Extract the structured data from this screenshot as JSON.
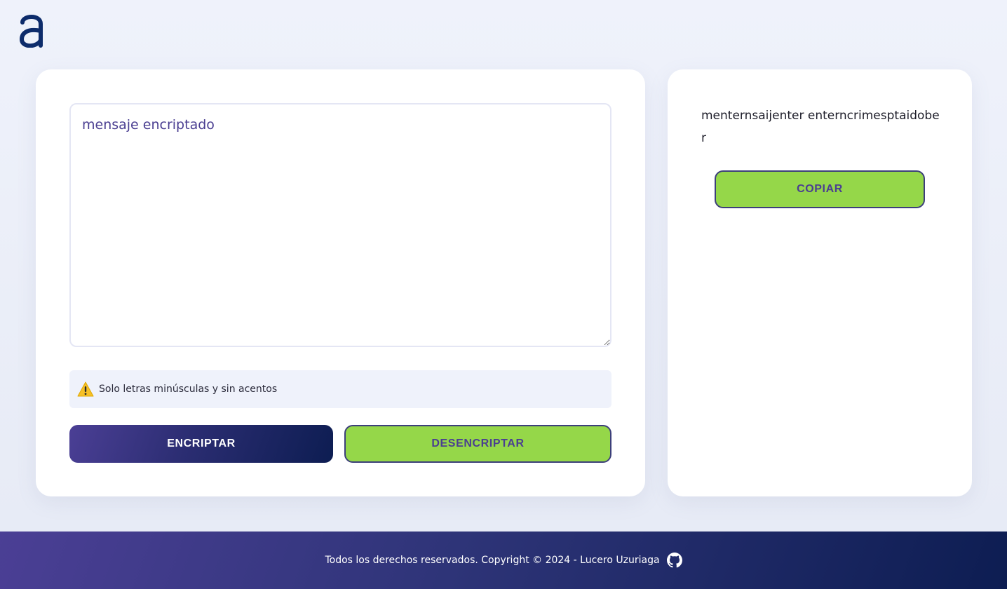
{
  "header": {
    "logo_icon": "alura-logo-icon",
    "logo_color": "#0d2c6b"
  },
  "input_panel": {
    "textarea_value": "mensaje encriptado",
    "warning_icon": "warning-icon",
    "warning_text": "Solo letras minúsculas y sin acentos",
    "encrypt_label": "ENCRIPTAR",
    "decrypt_label": "DESENCRIPTAR"
  },
  "output_panel": {
    "result_text": "menternsaijenter enterncrimesptaidober",
    "copy_label": "COPIAR"
  },
  "footer": {
    "text": "Todos los derechos reservados. Copyright © 2024 - Lucero Uzuriaga",
    "github_icon": "github-icon"
  },
  "colors": {
    "accent_green": "#95d749",
    "accent_purple": "#4a3e91",
    "navy": "#0d1d52",
    "background": "#eff2fb"
  }
}
